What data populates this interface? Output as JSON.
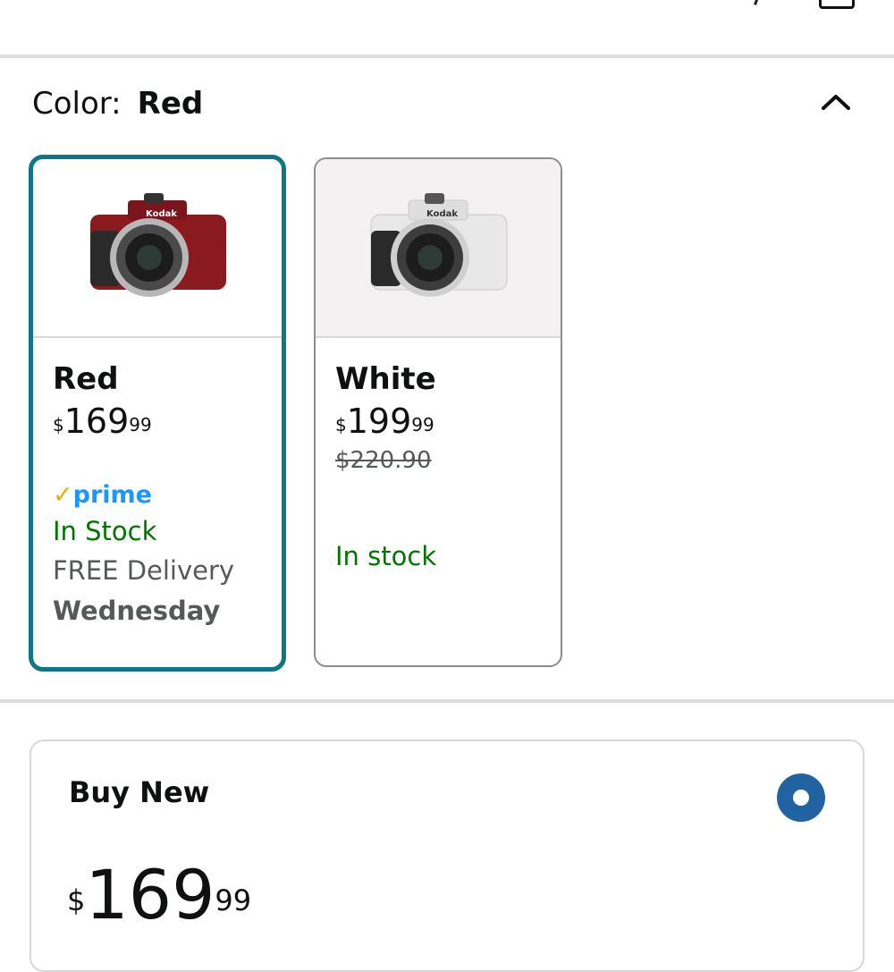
{
  "color_selector": {
    "label": "Color:",
    "selected_value": "Red"
  },
  "options": [
    {
      "name": "Red",
      "price_symbol": "$",
      "price_whole": "169",
      "price_cents": "99",
      "prime_label": "prime",
      "stock": "In Stock",
      "delivery": "FREE Delivery",
      "delivery_day": "Wednesday",
      "logo_text": "Kodak",
      "body_color": "#8b1a1f"
    },
    {
      "name": "White",
      "price_symbol": "$",
      "price_whole": "199",
      "price_cents": "99",
      "list_price": "$220.90",
      "stock": "In stock",
      "logo_text": "Kodak",
      "body_color": "#e8e8e8"
    }
  ],
  "buy_new": {
    "title": "Buy New",
    "price_symbol": "$",
    "price_whole": "169",
    "price_cents": "99"
  },
  "colors": {
    "selected_border": "#0f7688",
    "in_stock": "#007600",
    "prime_blue": "#1a98ff",
    "radio": "#2162a1"
  }
}
